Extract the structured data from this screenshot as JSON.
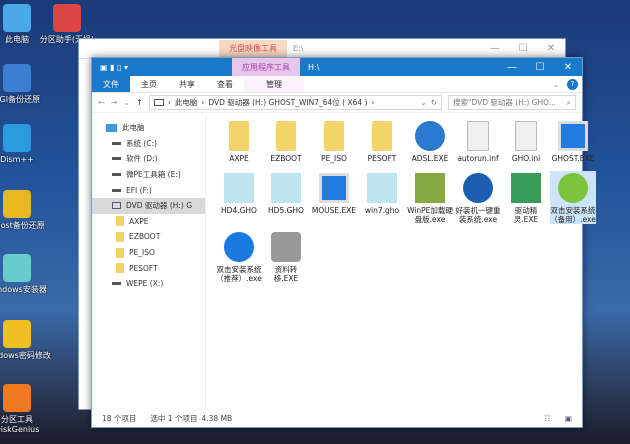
{
  "desktop": [
    {
      "label": "此电脑",
      "color": "#4aa8e8"
    },
    {
      "label": "分区助手(无损)",
      "color": "#d44"
    },
    {
      "label": "CGI备份还原",
      "color": "#3a7fd0"
    },
    {
      "label": "Dism++",
      "color": "#2a9be0"
    },
    {
      "label": "Ghost备份还原",
      "color": "#e8b820"
    },
    {
      "label": "Windows安装器",
      "color": "#6cc"
    },
    {
      "label": "Windows密码修改",
      "color": "#f0c020"
    },
    {
      "label": "分区工具DiskGenius",
      "color": "#f07820"
    }
  ],
  "back_window": {
    "context_tab": "光盘映像工具",
    "path": "E:\\",
    "min": "—",
    "max": "☐",
    "close": "✕"
  },
  "front_window": {
    "context_tab": "应用程序工具",
    "path": "H:\\",
    "min": "—",
    "max": "☐",
    "close": "✕",
    "ribbon_tabs": [
      "文件",
      "主页",
      "共享",
      "查看",
      "管理"
    ],
    "address": {
      "crumbs": [
        "此电脑",
        "DVD 驱动器 (H:) GHOST_WIN7_64位 ( X64 )"
      ],
      "search_placeholder": "搜索\"DVD 驱动器 (H:) GHO..."
    },
    "nav": [
      {
        "label": "此电脑",
        "type": "pc"
      },
      {
        "label": "系统 (C:)",
        "type": "drive"
      },
      {
        "label": "软件 (D:)",
        "type": "drive"
      },
      {
        "label": "微PE工具箱 (E:)",
        "type": "drive"
      },
      {
        "label": "EFI (F:)",
        "type": "drive"
      },
      {
        "label": "DVD 驱动器 (H:) G",
        "type": "dvd",
        "selected": true
      },
      {
        "label": "AXPE",
        "type": "folder"
      },
      {
        "label": "EZBOOT",
        "type": "folder"
      },
      {
        "label": "PE_ISO",
        "type": "folder"
      },
      {
        "label": "PESOFT",
        "type": "folder"
      },
      {
        "label": "WEPE (X:)",
        "type": "drive"
      }
    ],
    "files": [
      {
        "name": "AXPE",
        "type": "folder"
      },
      {
        "name": "EZBOOT",
        "type": "folder"
      },
      {
        "name": "PE_ISO",
        "type": "folder"
      },
      {
        "name": "PESOFT",
        "type": "folder"
      },
      {
        "name": "ADSL.EXE",
        "type": "globe"
      },
      {
        "name": "autorun.inf",
        "type": "doc"
      },
      {
        "name": "GHO.ini",
        "type": "doc"
      },
      {
        "name": "GHOST.EXE",
        "type": "window"
      },
      {
        "name": "HD4.GHO",
        "type": "ghost"
      },
      {
        "name": "HD5.GHO",
        "type": "ghost"
      },
      {
        "name": "MOUSE.EXE",
        "type": "window"
      },
      {
        "name": "win7.gho",
        "type": "ghost"
      },
      {
        "name": "WinPE加载硬盘版.exe",
        "type": "tools"
      },
      {
        "name": "好装机一键重装系统.exe",
        "type": "eye"
      },
      {
        "name": "驱动精灵.EXE",
        "type": "card"
      },
      {
        "name": "双击安装系统（备用）.exe",
        "type": "green",
        "selected": true
      },
      {
        "name": "双击安装系统（推荐）.exe",
        "type": "blue"
      },
      {
        "name": "资料转移.EXE",
        "type": "user"
      }
    ],
    "status": {
      "count": "18 个项目",
      "selected": "选中 1 个项目",
      "size": "4.38 MB"
    }
  },
  "accent": "#1979ca"
}
